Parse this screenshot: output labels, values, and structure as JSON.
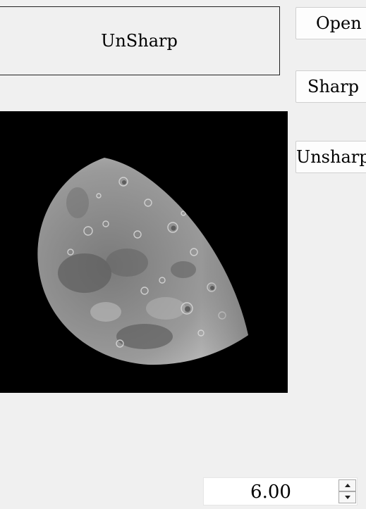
{
  "title_label": "UnSharp",
  "buttons": {
    "open": "Open",
    "sharp": "Sharp",
    "unsharp": "Unsharp"
  },
  "image": {
    "subject": "moon-photo",
    "background": "#000000"
  },
  "amount_spinbox": {
    "value": "6.00"
  },
  "colors": {
    "window_bg": "#f0f0f0",
    "button_bg": "#fdfdfd",
    "border": "#222222"
  }
}
